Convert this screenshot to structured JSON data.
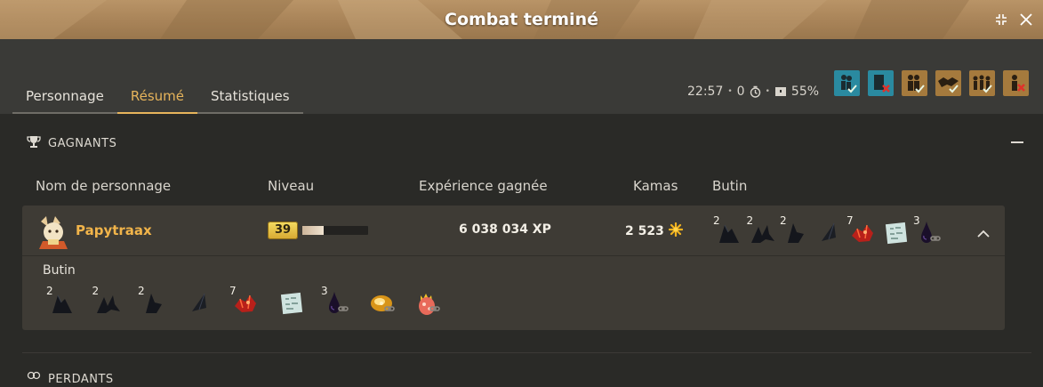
{
  "window": {
    "title": "Combat terminé"
  },
  "tabs": [
    {
      "label": "Personnage",
      "active": false
    },
    {
      "label": "Résumé",
      "active": true
    },
    {
      "label": "Statistiques",
      "active": false
    }
  ],
  "combat_stats": {
    "duration": "22:57",
    "turns": "0",
    "percent": "55%"
  },
  "option_buttons": [
    {
      "icon": "party-check-icon",
      "color": "#2a8aa0"
    },
    {
      "icon": "party-cross-icon",
      "color": "#2a8aa0"
    },
    {
      "icon": "duo-check-icon",
      "color": "#a57a3d"
    },
    {
      "icon": "handshake-check-icon",
      "color": "#a57a3d"
    },
    {
      "icon": "group-check-icon",
      "color": "#a57a3d"
    },
    {
      "icon": "person-cross-icon",
      "color": "#a57a3d"
    }
  ],
  "winners": {
    "section_title": "GAGNANTS",
    "columns": {
      "name": "Nom de personnage",
      "level": "Niveau",
      "xp": "Expérience gagnée",
      "kamas": "Kamas",
      "loot": "Butin"
    },
    "rows": [
      {
        "name": "Papytraax",
        "level": "39",
        "level_progress": 0.32,
        "xp": "6 038 034 XP",
        "kamas": "2 523",
        "loot_preview": [
          {
            "qty": "2",
            "icon": "dark-wing-icon"
          },
          {
            "qty": "2",
            "icon": "dark-bird-icon"
          },
          {
            "qty": "2",
            "icon": "dark-fin-icon"
          },
          {
            "qty": "",
            "icon": "dark-shard-icon"
          },
          {
            "qty": "7",
            "icon": "red-crystal-icon"
          },
          {
            "qty": "",
            "icon": "map-scroll-icon"
          },
          {
            "qty": "3",
            "icon": "dark-drop-icon"
          }
        ],
        "loot_label": "Butin",
        "loot_full": [
          {
            "qty": "2",
            "icon": "dark-wing-icon"
          },
          {
            "qty": "2",
            "icon": "dark-bird-icon"
          },
          {
            "qty": "2",
            "icon": "dark-fin-icon"
          },
          {
            "qty": "",
            "icon": "dark-shard-icon"
          },
          {
            "qty": "7",
            "icon": "red-crystal-icon"
          },
          {
            "qty": "",
            "icon": "map-scroll-icon"
          },
          {
            "qty": "3",
            "icon": "dark-drop-icon"
          },
          {
            "qty": "",
            "icon": "golden-egg-icon"
          },
          {
            "qty": "",
            "icon": "crowned-egg-icon"
          }
        ]
      }
    ]
  },
  "losers": {
    "section_title": "PERDANTS"
  },
  "colors": {
    "accent": "#e7b45b",
    "name": "#f1b44a",
    "panel": "#3e3b35",
    "background": "#2a2a27"
  }
}
